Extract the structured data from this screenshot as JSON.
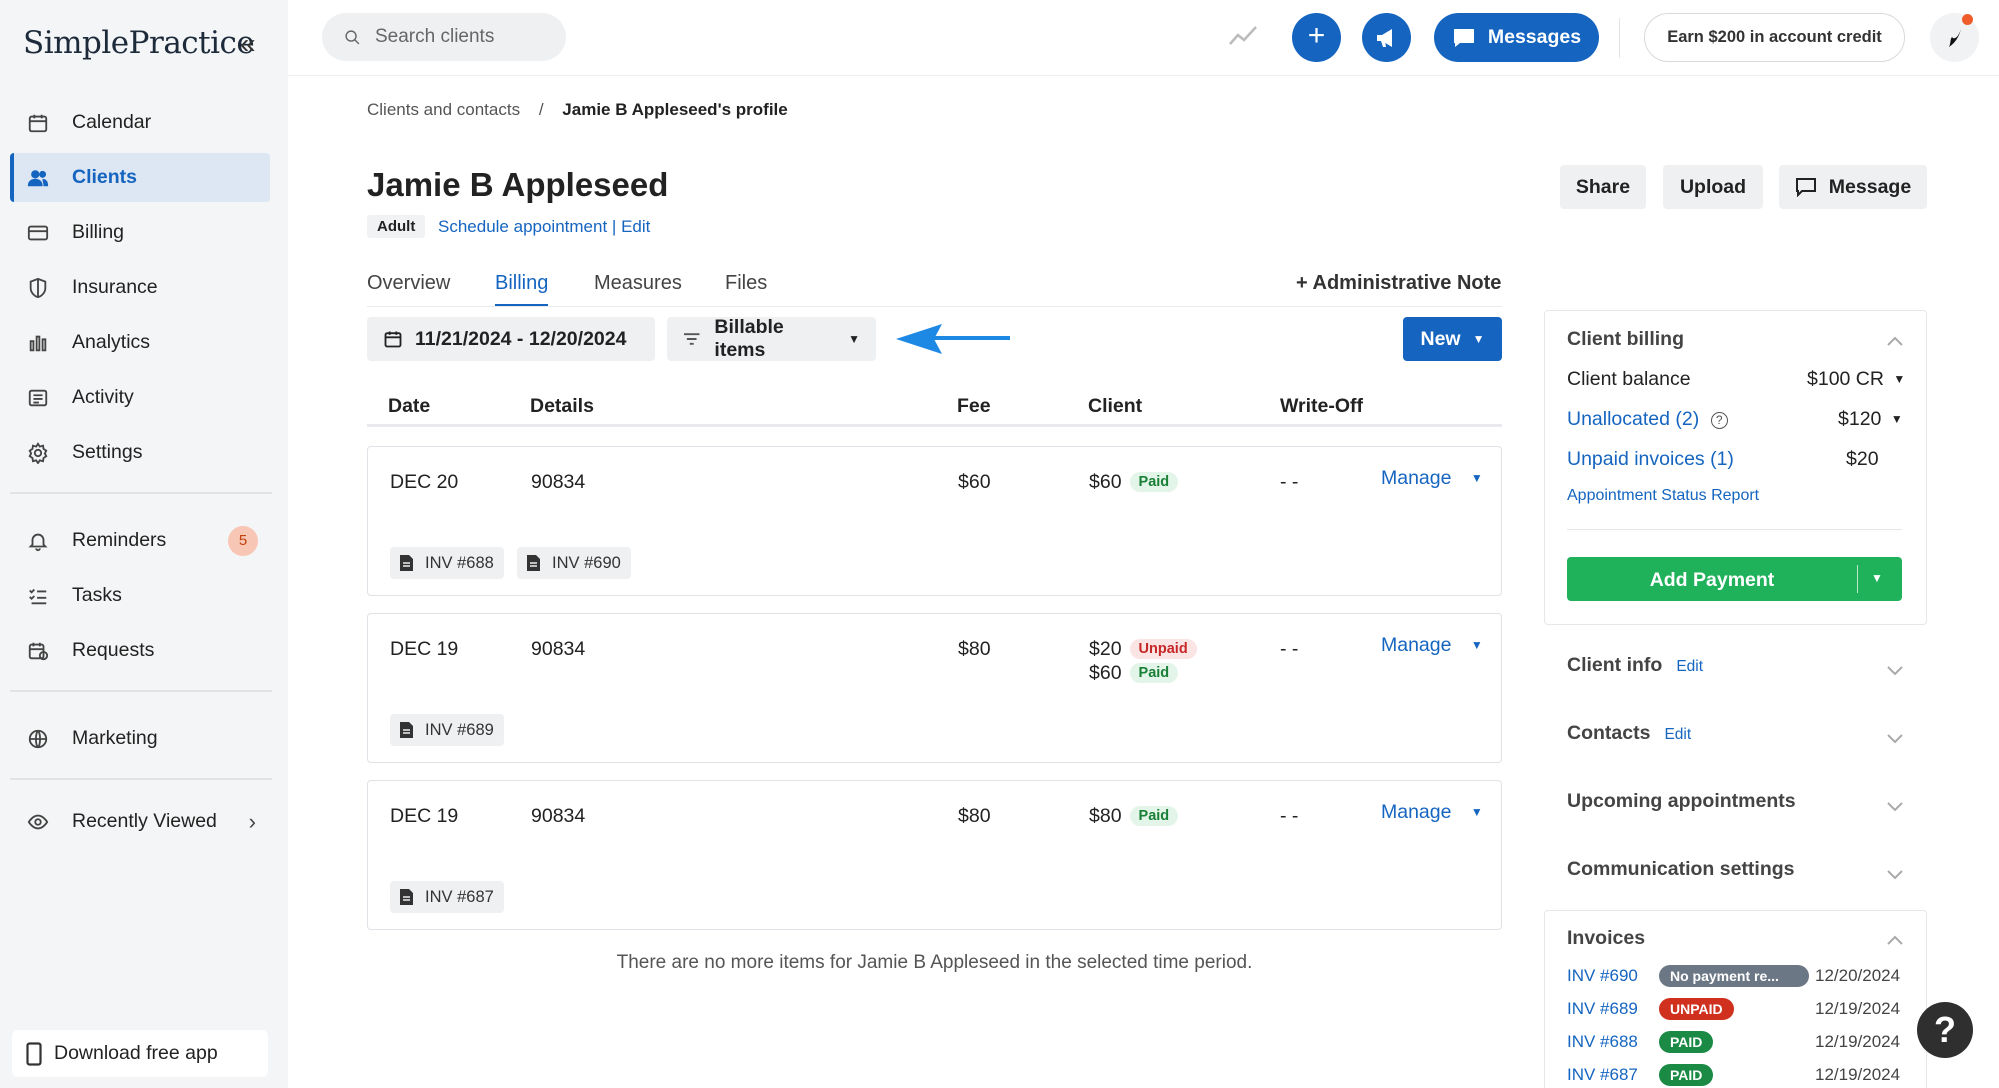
{
  "brand": {
    "name": "SimplePractice"
  },
  "sidebar": {
    "items": [
      {
        "label": "Calendar",
        "icon": "calendar-icon"
      },
      {
        "label": "Clients",
        "icon": "clients-icon",
        "active": true
      },
      {
        "label": "Billing",
        "icon": "billing-card-icon"
      },
      {
        "label": "Insurance",
        "icon": "shield-icon"
      },
      {
        "label": "Analytics",
        "icon": "bar-chart-icon"
      },
      {
        "label": "Activity",
        "icon": "activity-list-icon"
      },
      {
        "label": "Settings",
        "icon": "gear-icon"
      }
    ],
    "secondary": [
      {
        "label": "Reminders",
        "icon": "bell-icon",
        "badge": "5"
      },
      {
        "label": "Tasks",
        "icon": "tasks-icon"
      },
      {
        "label": "Requests",
        "icon": "requests-icon"
      }
    ],
    "marketing": {
      "label": "Marketing",
      "icon": "globe-icon"
    },
    "recently_viewed": {
      "label": "Recently Viewed",
      "icon": "eye-icon"
    },
    "download": {
      "label": "Download free app",
      "icon": "phone-icon"
    }
  },
  "topbar": {
    "search_placeholder": "Search clients",
    "messages_label": "Messages",
    "earn_label": "Earn $200 in account credit"
  },
  "breadcrumb": {
    "parent": "Clients and contacts",
    "separator": "/",
    "current": "Jamie B Appleseed's profile"
  },
  "client": {
    "name": "Jamie B Appleseed",
    "tag": "Adult",
    "schedule_label": "Schedule appointment",
    "edit_label": "Edit"
  },
  "header_buttons": {
    "share": "Share",
    "upload": "Upload",
    "message": "Message"
  },
  "tabs": [
    {
      "label": "Overview"
    },
    {
      "label": "Billing",
      "active": true
    },
    {
      "label": "Measures"
    },
    {
      "label": "Files"
    }
  ],
  "admin_note": "+ Administrative Note",
  "filters": {
    "date_range": "11/21/2024 - 12/20/2024",
    "type": "Billable items"
  },
  "new_button": "New",
  "table": {
    "headers": {
      "date": "Date",
      "details": "Details",
      "fee": "Fee",
      "client": "Client",
      "writeoff": "Write-Off"
    },
    "rows": [
      {
        "date": "DEC 20",
        "details": "90834",
        "fee": "$60",
        "client": [
          {
            "amount": "$60",
            "status": "Paid"
          }
        ],
        "writeoff": "- -",
        "manage": "Manage",
        "invoices": [
          "INV #688",
          "INV #690"
        ]
      },
      {
        "date": "DEC 19",
        "details": "90834",
        "fee": "$80",
        "client": [
          {
            "amount": "$20",
            "status": "Unpaid"
          },
          {
            "amount": "$60",
            "status": "Paid"
          }
        ],
        "writeoff": "- -",
        "manage": "Manage",
        "invoices": [
          "INV #689"
        ]
      },
      {
        "date": "DEC 19",
        "details": "90834",
        "fee": "$80",
        "client": [
          {
            "amount": "$80",
            "status": "Paid"
          }
        ],
        "writeoff": "- -",
        "manage": "Manage",
        "invoices": [
          "INV #687"
        ]
      }
    ],
    "empty_message": "There are no more items for Jamie B Appleseed in the selected time period."
  },
  "client_billing": {
    "title": "Client billing",
    "balance_label": "Client balance",
    "balance_value": "$100 CR",
    "unallocated_label": "Unallocated (2)",
    "unallocated_value": "$120",
    "unpaid_label": "Unpaid invoices (1)",
    "unpaid_value": "$20",
    "report_link": "Appointment Status Report",
    "add_payment": "Add Payment"
  },
  "sections": [
    {
      "title": "Client info",
      "edit": "Edit"
    },
    {
      "title": "Contacts",
      "edit": "Edit"
    },
    {
      "title": "Upcoming appointments",
      "edit": ""
    },
    {
      "title": "Communication settings",
      "edit": ""
    }
  ],
  "invoices": {
    "title": "Invoices",
    "items": [
      {
        "id": "INV #690",
        "status": "No payment re...",
        "color": "#6b7785",
        "date": "12/20/2024"
      },
      {
        "id": "INV #689",
        "status": "UNPAID",
        "color": "#d0311f",
        "date": "12/19/2024"
      },
      {
        "id": "INV #688",
        "status": "PAID",
        "color": "#1a8a44",
        "date": "12/19/2024"
      },
      {
        "id": "INV #687",
        "status": "PAID",
        "color": "#1a8a44",
        "date": "12/19/2024"
      }
    ]
  },
  "colors": {
    "primary": "#1565c0",
    "success": "#1fb25a",
    "sidebar_bg": "#f4f5f6"
  }
}
